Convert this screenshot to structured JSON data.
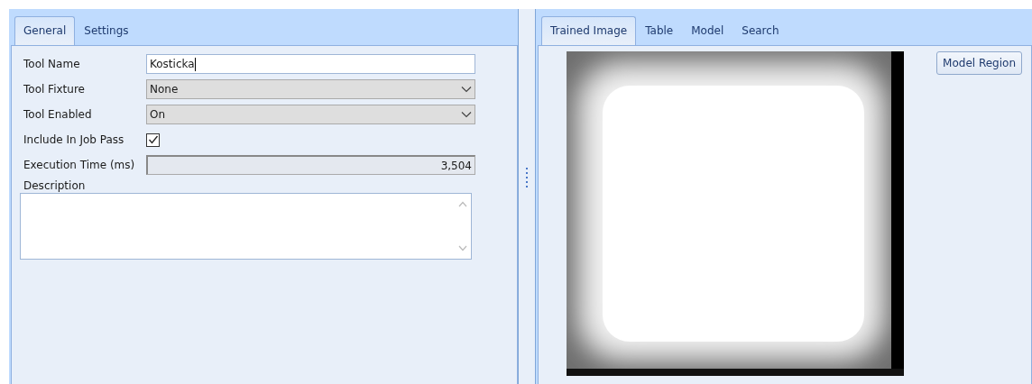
{
  "left_panel": {
    "tabs": [
      {
        "label": "General",
        "selected": true
      },
      {
        "label": "Settings",
        "selected": false
      }
    ],
    "fields": [
      {
        "kind": "text",
        "label": "Tool Name",
        "value": "Kosticka"
      },
      {
        "kind": "dropdown",
        "label": "Tool Fixture",
        "value": "None"
      },
      {
        "kind": "dropdown",
        "label": "Tool Enabled",
        "value": "On"
      },
      {
        "kind": "checkbox",
        "label": "Include In Job Pass",
        "checked": true
      },
      {
        "kind": "readonly",
        "label": "Execution Time (ms)",
        "value": "3,504"
      }
    ],
    "description": {
      "label": "Description"
    }
  },
  "right_panel": {
    "tabs": [
      {
        "label": "Trained Image",
        "selected": true
      },
      {
        "label": "Table",
        "selected": false
      },
      {
        "label": "Model",
        "selected": false
      },
      {
        "label": "Search",
        "selected": false
      }
    ],
    "image": {
      "kind": "picture"
    },
    "buttons": [
      "Model Region"
    ]
  }
}
